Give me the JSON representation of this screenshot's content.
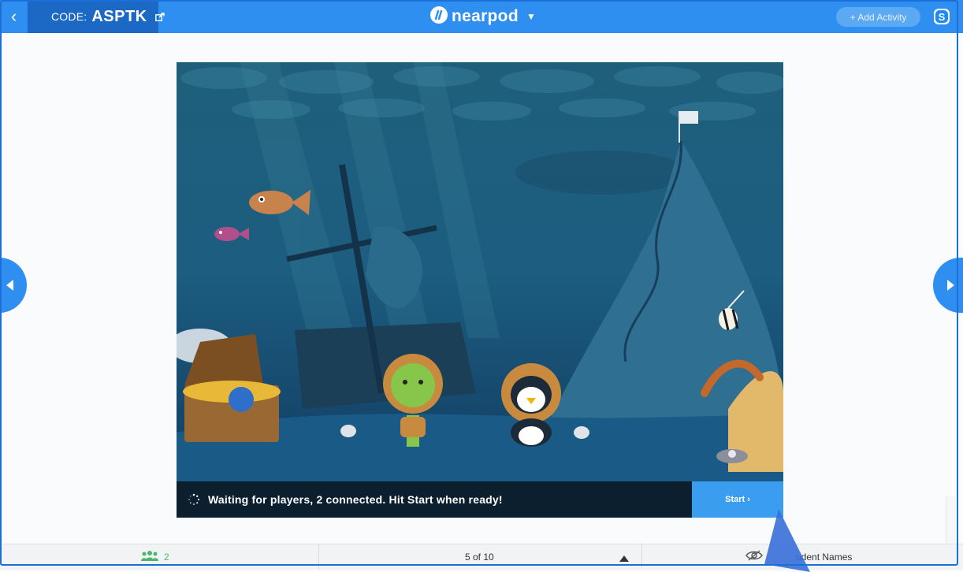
{
  "header": {
    "back_icon": "chevron-left-icon",
    "code_label": "CODE:",
    "code_value": "ASPTK",
    "brand": "nearpod",
    "add_activity": "+ Add Activity",
    "colors": {
      "bar": "#2f8ff0",
      "code_box": "#1c68c5",
      "add_button": "#5aa9f2"
    }
  },
  "slide": {
    "status_text": "Waiting for players, 2 connected. Hit Start when ready!",
    "start_label": "Start ›"
  },
  "footer": {
    "students_count": "2",
    "page_indicator": "5 of 10",
    "names_label": "udent Names"
  }
}
